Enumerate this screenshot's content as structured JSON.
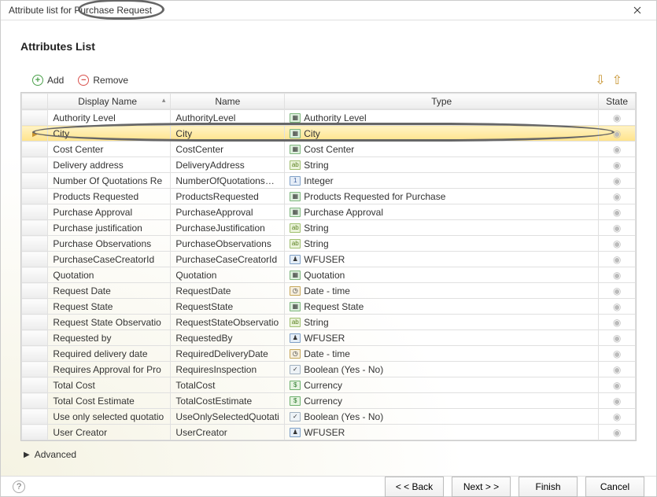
{
  "window": {
    "title": "Attribute list for Purchase Request",
    "heading": "Attributes List"
  },
  "toolbar": {
    "add": "Add",
    "remove": "Remove"
  },
  "columns": {
    "disp": "Display Name",
    "name": "Name",
    "type": "Type",
    "state": "State"
  },
  "rows": [
    {
      "disp": "Authority Level",
      "name": "AuthorityLevel",
      "type": "Authority Level",
      "icon": "entity"
    },
    {
      "disp": "City",
      "name": "City",
      "type": "City",
      "icon": "entity",
      "selected": true
    },
    {
      "disp": "Cost Center",
      "name": "CostCenter",
      "type": "Cost Center",
      "icon": "entity"
    },
    {
      "disp": "Delivery address",
      "name": "DeliveryAddress",
      "type": "String",
      "icon": "string"
    },
    {
      "disp": "Number Of Quotations Re",
      "name": "NumberOfQuotationsReq",
      "type": "Integer",
      "icon": "int"
    },
    {
      "disp": "Products Requested",
      "name": "ProductsRequested",
      "type": "Products Requested for Purchase",
      "icon": "entity"
    },
    {
      "disp": "Purchase Approval",
      "name": "PurchaseApproval",
      "type": "Purchase Approval",
      "icon": "entity"
    },
    {
      "disp": "Purchase justification",
      "name": "PurchaseJustification",
      "type": "String",
      "icon": "string"
    },
    {
      "disp": "Purchase Observations",
      "name": "PurchaseObservations",
      "type": "String",
      "icon": "string"
    },
    {
      "disp": "PurchaseCaseCreatorId",
      "name": "PurchaseCaseCreatorId",
      "type": "WFUSER",
      "icon": "user"
    },
    {
      "disp": "Quotation",
      "name": "Quotation",
      "type": "Quotation",
      "icon": "entity"
    },
    {
      "disp": "Request Date",
      "name": "RequestDate",
      "type": "Date - time",
      "icon": "date"
    },
    {
      "disp": "Request State",
      "name": "RequestState",
      "type": "Request State",
      "icon": "entity"
    },
    {
      "disp": "Request State Observatio",
      "name": "RequestStateObservatio",
      "type": "String",
      "icon": "string"
    },
    {
      "disp": "Requested by",
      "name": "RequestedBy",
      "type": "WFUSER",
      "icon": "user"
    },
    {
      "disp": "Required delivery date",
      "name": "RequiredDeliveryDate",
      "type": "Date - time",
      "icon": "date"
    },
    {
      "disp": "Requires Approval for Pro",
      "name": "RequiresInspection",
      "type": "Boolean (Yes - No)",
      "icon": "bool"
    },
    {
      "disp": "Total Cost",
      "name": "TotalCost",
      "type": "Currency",
      "icon": "curr"
    },
    {
      "disp": "Total Cost Estimate",
      "name": "TotalCostEstimate",
      "type": "Currency",
      "icon": "curr"
    },
    {
      "disp": "Use only selected quotatio",
      "name": "UseOnlySelectedQuotati",
      "type": "Boolean (Yes - No)",
      "icon": "bool"
    },
    {
      "disp": "User Creator",
      "name": "UserCreator",
      "type": "WFUSER",
      "icon": "user"
    }
  ],
  "advanced": "Advanced",
  "footer": {
    "back": "< < Back",
    "next": "Next > >",
    "finish": "Finish",
    "cancel": "Cancel"
  },
  "icon_glyphs": {
    "entity": "▦",
    "string": "ab",
    "int": "1",
    "date": "◷",
    "user": "♟",
    "bool": "✓",
    "curr": "$"
  }
}
